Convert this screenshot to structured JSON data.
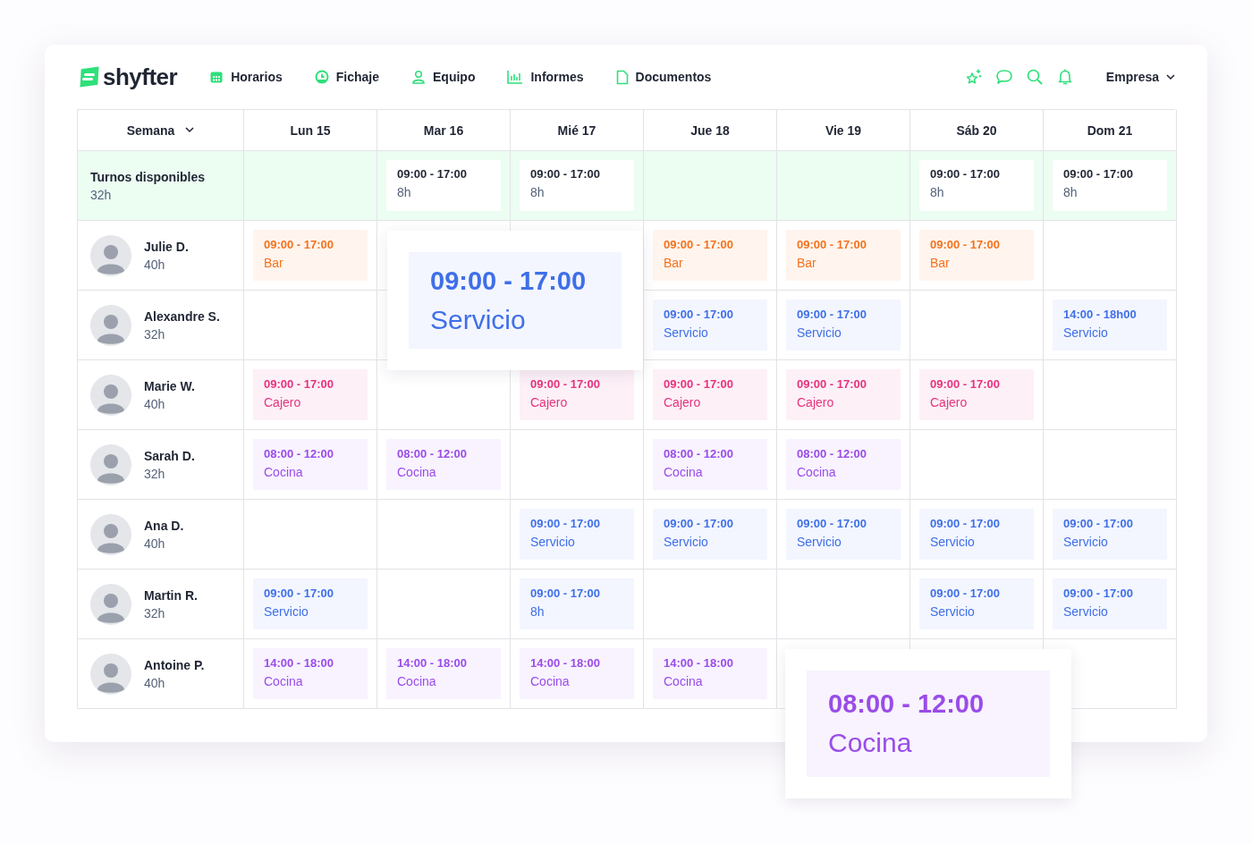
{
  "brand": "shyfter",
  "nav": [
    {
      "label": "Horarios"
    },
    {
      "label": "Fichaje"
    },
    {
      "label": "Equipo"
    },
    {
      "label": "Informes"
    },
    {
      "label": "Documentos"
    }
  ],
  "account": {
    "label": "Empresa"
  },
  "week_selector": {
    "label": "Semana"
  },
  "days": [
    "Lun 15",
    "Mar 16",
    "Mié 17",
    "Jue 18",
    "Vie 19",
    "Sáb 20",
    "Dom 21"
  ],
  "available": {
    "label": "Turnos disponibles",
    "hours": "32h",
    "shifts": [
      {
        "kind": "empty"
      },
      {
        "kind": "open",
        "time": "09:00 - 17:00",
        "hours": "8h"
      },
      {
        "kind": "open",
        "time": "09:00 - 17:00",
        "hours": "8h"
      },
      {
        "kind": "empty"
      },
      {
        "kind": "empty"
      },
      {
        "kind": "open",
        "time": "09:00 - 17:00",
        "hours": "8h"
      },
      {
        "kind": "open",
        "time": "09:00 - 17:00",
        "hours": "8h"
      }
    ]
  },
  "employees": [
    {
      "name": "Julie D.",
      "hours": "40h",
      "shifts": [
        {
          "time": "09:00 - 17:00",
          "role": "Bar",
          "kind": "bar"
        },
        {
          "kind": "empty"
        },
        {
          "kind": "empty"
        },
        {
          "time": "09:00 - 17:00",
          "role": "Bar",
          "kind": "bar"
        },
        {
          "time": "09:00 - 17:00",
          "role": "Bar",
          "kind": "bar"
        },
        {
          "time": "09:00 - 17:00",
          "role": "Bar",
          "kind": "bar"
        },
        {
          "kind": "empty"
        }
      ]
    },
    {
      "name": "Alexandre S.",
      "hours": "32h",
      "shifts": [
        {
          "kind": "empty"
        },
        {
          "kind": "empty"
        },
        {
          "kind": "empty"
        },
        {
          "time": "09:00 - 17:00",
          "role": "Servicio",
          "kind": "servicio"
        },
        {
          "time": "09:00 - 17:00",
          "role": "Servicio",
          "kind": "servicio"
        },
        {
          "kind": "empty"
        },
        {
          "time": "14:00 - 18h00",
          "role": "Servicio",
          "kind": "servicio"
        }
      ]
    },
    {
      "name": "Marie W.",
      "hours": "40h",
      "shifts": [
        {
          "time": "09:00 - 17:00",
          "role": "Cajero",
          "kind": "cajero"
        },
        {
          "kind": "empty"
        },
        {
          "time": "09:00 - 17:00",
          "role": "Cajero",
          "kind": "cajero"
        },
        {
          "time": "09:00 - 17:00",
          "role": "Cajero",
          "kind": "cajero"
        },
        {
          "time": "09:00 - 17:00",
          "role": "Cajero",
          "kind": "cajero"
        },
        {
          "time": "09:00 - 17:00",
          "role": "Cajero",
          "kind": "cajero"
        },
        {
          "kind": "empty"
        }
      ]
    },
    {
      "name": "Sarah D.",
      "hours": "32h",
      "shifts": [
        {
          "time": "08:00 - 12:00",
          "role": "Cocina",
          "kind": "cocina"
        },
        {
          "time": "08:00 - 12:00",
          "role": "Cocina",
          "kind": "cocina"
        },
        {
          "kind": "empty"
        },
        {
          "time": "08:00 - 12:00",
          "role": "Cocina",
          "kind": "cocina"
        },
        {
          "time": "08:00 - 12:00",
          "role": "Cocina",
          "kind": "cocina"
        },
        {
          "kind": "empty"
        },
        {
          "kind": "empty"
        }
      ]
    },
    {
      "name": "Ana D.",
      "hours": "40h",
      "shifts": [
        {
          "kind": "empty"
        },
        {
          "kind": "empty"
        },
        {
          "time": "09:00 - 17:00",
          "role": "Servicio",
          "kind": "servicio"
        },
        {
          "time": "09:00 - 17:00",
          "role": "Servicio",
          "kind": "servicio"
        },
        {
          "time": "09:00 - 17:00",
          "role": "Servicio",
          "kind": "servicio"
        },
        {
          "time": "09:00 - 17:00",
          "role": "Servicio",
          "kind": "servicio"
        },
        {
          "time": "09:00 - 17:00",
          "role": "Servicio",
          "kind": "servicio"
        }
      ]
    },
    {
      "name": "Martin R.",
      "hours": "32h",
      "shifts": [
        {
          "time": "09:00 - 17:00",
          "role": "Servicio",
          "kind": "servicio"
        },
        {
          "kind": "empty"
        },
        {
          "time": "09:00 - 17:00",
          "role": "8h",
          "kind": "servicio"
        },
        {
          "kind": "empty"
        },
        {
          "kind": "empty"
        },
        {
          "time": "09:00 - 17:00",
          "role": "Servicio",
          "kind": "servicio"
        },
        {
          "time": "09:00 - 17:00",
          "role": "Servicio",
          "kind": "servicio"
        }
      ]
    },
    {
      "name": "Antoine P.",
      "hours": "40h",
      "shifts": [
        {
          "time": "14:00 - 18:00",
          "role": "Cocina",
          "kind": "cocina"
        },
        {
          "time": "14:00 - 18:00",
          "role": "Cocina",
          "kind": "cocina"
        },
        {
          "time": "14:00 - 18:00",
          "role": "Cocina",
          "kind": "cocina"
        },
        {
          "time": "14:00 - 18:00",
          "role": "Cocina",
          "kind": "cocina"
        },
        {
          "kind": "empty"
        },
        {
          "kind": "empty"
        },
        {
          "kind": "empty"
        }
      ]
    }
  ],
  "highlights": [
    {
      "time": "09:00 - 17:00",
      "role": "Servicio",
      "kind": "servicio"
    },
    {
      "time": "08:00 - 12:00",
      "role": "Cocina",
      "kind": "cocina"
    }
  ]
}
